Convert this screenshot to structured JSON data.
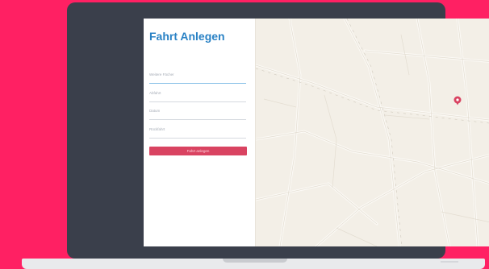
{
  "form": {
    "title": "Fahrt Anlegen",
    "fields": [
      {
        "placeholder": "Weitere Fächer"
      },
      {
        "placeholder": "Abfahrt"
      },
      {
        "placeholder": "Datum"
      },
      {
        "placeholder": "Rückfahrt"
      }
    ],
    "submit_label": "Fahrt anlegen"
  },
  "map": {
    "marker_icon": "location-pin-icon",
    "marker_color": "#d94361"
  },
  "colors": {
    "background": "#ff2063",
    "laptop_frame": "#3a3f4b",
    "title": "#2a82c5",
    "button": "#d94361",
    "map_base": "#f3efe7"
  }
}
